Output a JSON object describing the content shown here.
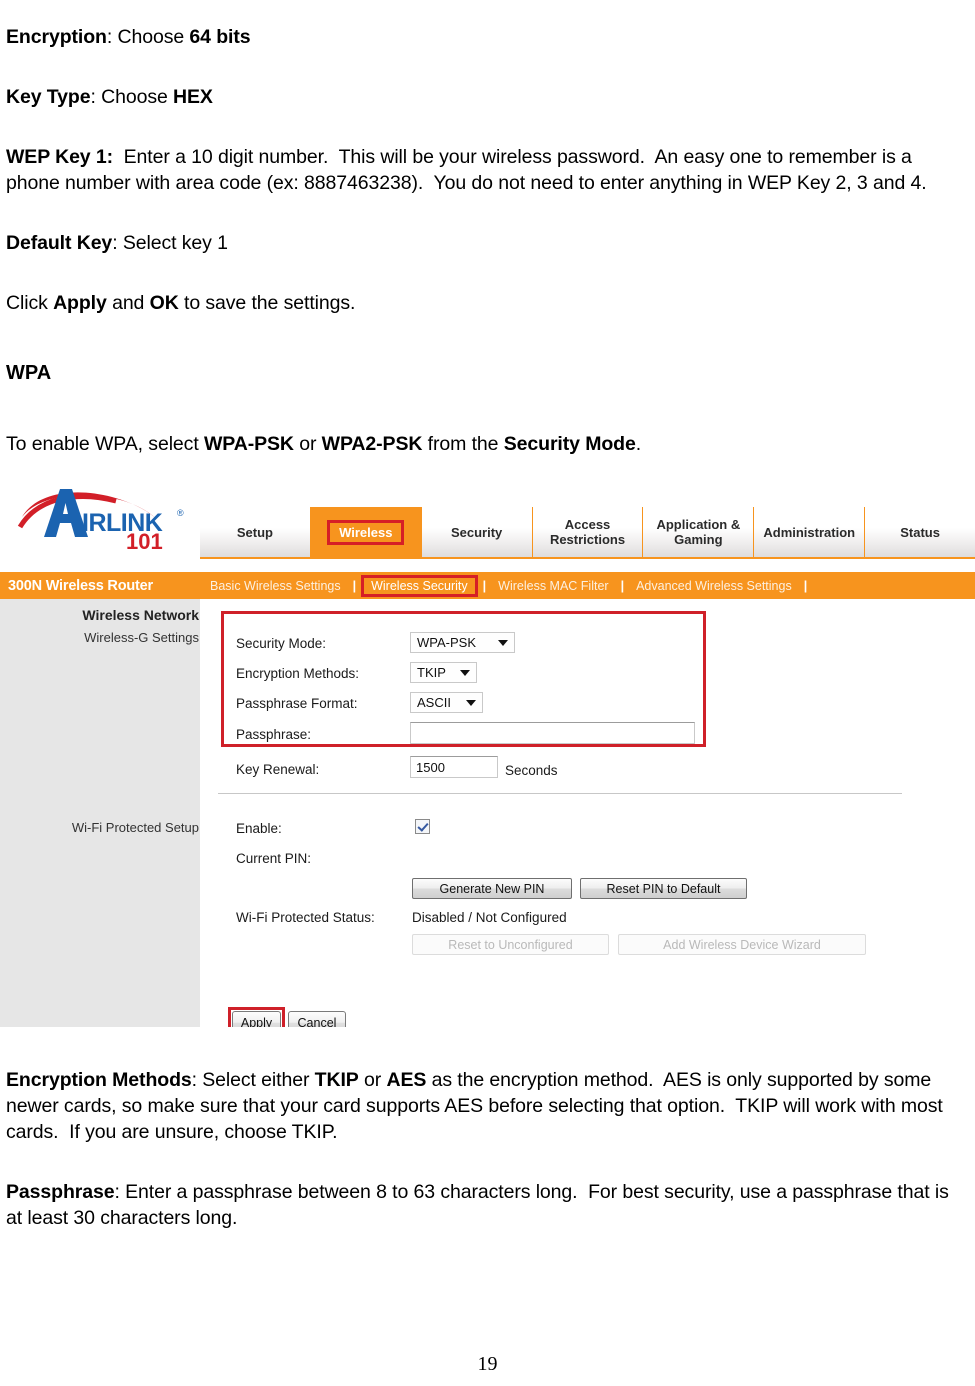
{
  "document": {
    "paragraphs": [
      {
        "id": "p-encryption",
        "html": "<b>Encryption</b>: Choose <b>64 bits</b>"
      },
      {
        "id": "p-keytype",
        "html": "<b>Key Type</b>: Choose <b>HEX</b>"
      },
      {
        "id": "p-wepkey1",
        "html": "<b>WEP Key 1:</b>&nbsp; Enter a 10 digit number.&nbsp; This will be your wireless password.&nbsp; An easy one to remember is a phone number with area code (ex: 8887463238).&nbsp; You do not need to enter anything in WEP Key 2, 3 and 4."
      },
      {
        "id": "p-defaultkey",
        "html": "<b>Default Key</b>: Select key 1"
      },
      {
        "id": "p-clickapply",
        "html": "Click <b>Apply</b> and <b>OK</b> to save the settings."
      }
    ],
    "heading_wpa": "WPA",
    "paragraph_wpa_intro": "To enable WPA, select <b>WPA-PSK</b> or <b>WPA2-PSK</b> from the <b>Security Mode</b>.",
    "paragraphs_after": [
      {
        "id": "p-encmethods",
        "html": "<b>Encryption Methods</b>: Select either <b>TKIP</b> or <b>AES</b> as the encryption method.&nbsp; AES is only supported by some newer cards, so make sure that your card supports AES before selecting that option.&nbsp; TKIP will work with most cards.&nbsp; If you are unsure, choose TKIP."
      },
      {
        "id": "p-passphrase",
        "html": "<b>Passphrase</b>: Enter a passphrase between 8 to 63 characters long.&nbsp; For best security, use a passphrase that is at least 30 characters long."
      }
    ],
    "page_number": "19"
  },
  "screenshot": {
    "logo": {
      "brand": "AIRLINK",
      "brand_lead": "A",
      "brand_rest": "IRLINK",
      "registered": "®",
      "sub": "101",
      "colors": {
        "brand_blue": "#1b63b0",
        "swoosh_red": "#d21f28",
        "sub_red": "#d21f28"
      }
    },
    "product_name": "300N Wireless Router",
    "tabs": [
      {
        "label": "Setup",
        "active": false
      },
      {
        "label": "Wireless",
        "active": true
      },
      {
        "label": "Security",
        "active": false
      },
      {
        "label": "Access Restrictions",
        "active": false
      },
      {
        "label": "Application & Gaming",
        "active": false
      },
      {
        "label": "Administration",
        "active": false
      },
      {
        "label": "Status",
        "active": false
      }
    ],
    "subnav": [
      {
        "label": "Basic Wireless Settings",
        "active": false
      },
      {
        "label": "Wireless Security",
        "active": true
      },
      {
        "label": "Wireless MAC Filter",
        "active": false
      },
      {
        "label": "Advanced Wireless Settings",
        "active": false
      }
    ],
    "sidebar": {
      "heading": "Wireless Network",
      "sub_item": "Wireless-G Settings",
      "sub_item_2": "Wi-Fi Protected Setup"
    },
    "form": {
      "security_mode": {
        "label": "Security Mode:",
        "value": "WPA-PSK"
      },
      "encryption_methods": {
        "label": "Encryption Methods:",
        "value": "TKIP"
      },
      "passphrase_format": {
        "label": "Passphrase Format:",
        "value": "ASCII"
      },
      "passphrase": {
        "label": "Passphrase:",
        "value": ""
      },
      "key_renewal": {
        "label": "Key Renewal:",
        "value": "1500",
        "unit": "Seconds"
      }
    },
    "wps": {
      "enable": {
        "label": "Enable:",
        "checked": true
      },
      "current_pin": {
        "label": "Current PIN:",
        "value": ""
      },
      "generate_pin_button": "Generate New PIN",
      "reset_pin_button": "Reset PIN to Default",
      "status": {
        "label": "Wi-Fi Protected Status:",
        "value": "Disabled / Not Configured"
      },
      "reset_unconfigured_button": "Reset to Unconfigured",
      "add_device_wizard_button": "Add Wireless Device Wizard"
    },
    "actions": {
      "apply_button": "Apply",
      "cancel_button": "Cancel"
    },
    "colors": {
      "orange": "#f7941e",
      "annotation_red": "#cf2029",
      "sidebar_gray": "#e6e6e6"
    }
  }
}
